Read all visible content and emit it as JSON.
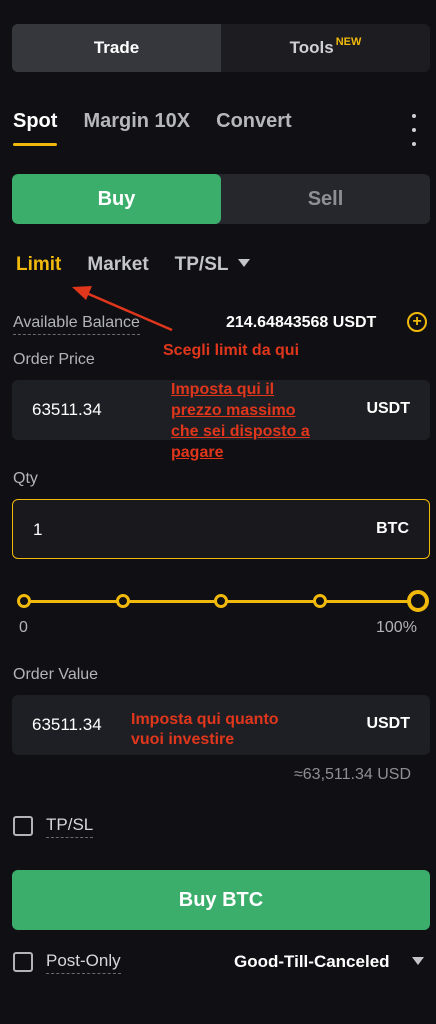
{
  "top_segment": {
    "trade": "Trade",
    "tools": "Tools",
    "tools_badge": "NEW"
  },
  "tabs": [
    "Spot",
    "Margin 10X",
    "Convert"
  ],
  "side": {
    "buy": "Buy",
    "sell": "Sell"
  },
  "order_types": {
    "limit": "Limit",
    "market": "Market",
    "tpsl": "TP/SL"
  },
  "balance": {
    "label": "Available Balance",
    "value": "214.64843568 USDT"
  },
  "order_price": {
    "label": "Order Price",
    "value": "63511.34",
    "unit": "USDT"
  },
  "qty": {
    "label": "Qty",
    "value": "1",
    "unit": "BTC"
  },
  "slider": {
    "min_label": "0",
    "max_label": "100%",
    "level_percent": 100
  },
  "order_value": {
    "label": "Order Value",
    "value": "63511.34",
    "unit": "USDT",
    "approx": "≈63,511.34 USD"
  },
  "tpsl_checkbox": "TP/SL",
  "buy_button": "Buy BTC",
  "post_only": "Post-Only",
  "time_in_force": "Good-Till-Canceled",
  "annotations": {
    "limit_note": "Scegli limit da qui",
    "price_note": [
      "Imposta qui il",
      "prezzo massimo",
      "che sei disposto a",
      "pagare"
    ],
    "value_note": [
      "Imposta qui quanto",
      "vuoi investire"
    ]
  },
  "colors": {
    "accent": "#f0b90b",
    "buy": "#3cae6c",
    "annotation": "#e0361c"
  }
}
